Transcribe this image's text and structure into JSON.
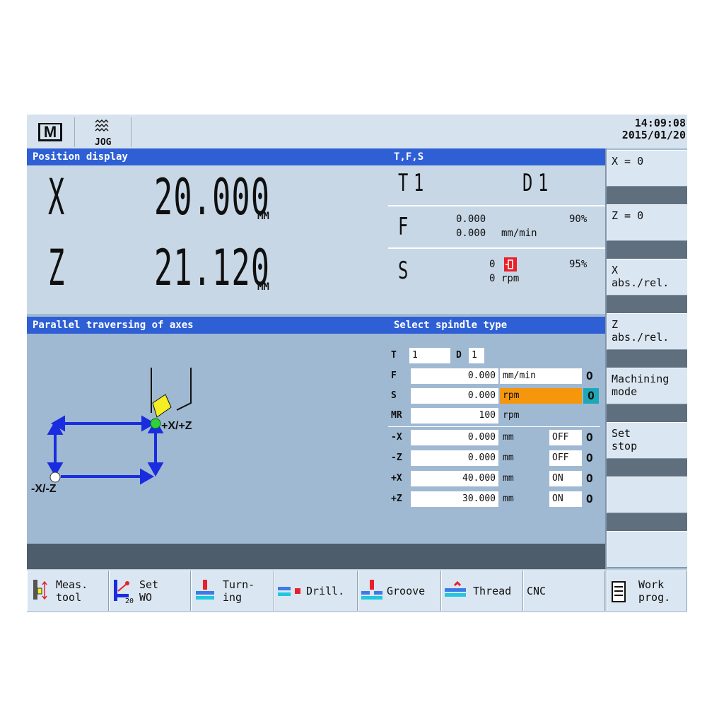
{
  "topbar": {
    "mode_label": "M",
    "jog_label": "JOG",
    "time": "14:09:08",
    "date": "2015/01/20"
  },
  "position": {
    "header": "Position display",
    "axes": [
      {
        "letter": "X",
        "value": "20.000",
        "unit": "MM"
      },
      {
        "letter": "Z",
        "value": "21.120",
        "unit": "MM"
      }
    ]
  },
  "tfs": {
    "header": "T,F,S",
    "t_label": "T",
    "t_value": "1",
    "d_label": "D",
    "d_value": "1",
    "f_label": "F",
    "f_value1": "0.000",
    "f_value2": "0.000",
    "f_unit": "mm/min",
    "f_percent": "90%",
    "s_label": "S",
    "s_value1": "0",
    "s_value2": "0",
    "s_unit": "rpm",
    "s_percent": "95%"
  },
  "traverse": {
    "header": "Parallel traversing of axes",
    "plus_label": "+X/+Z",
    "minus_label": "-X/-Z"
  },
  "spindle": {
    "header": "Select spindle type",
    "t_label": "T",
    "t_value": "1",
    "d_label": "D",
    "d_value": "1",
    "rows": [
      {
        "label": "F",
        "value": "0.000",
        "unit": "mm/min",
        "highlight": false
      },
      {
        "label": "S",
        "value": "0.000",
        "unit": "rpm",
        "highlight": true
      },
      {
        "label": "MR",
        "value": "100",
        "unit": "rpm",
        "highlight": false
      }
    ],
    "limits": [
      {
        "label": "-X",
        "value": "0.000",
        "unit": "mm",
        "state": "OFF"
      },
      {
        "label": "-Z",
        "value": "0.000",
        "unit": "mm",
        "state": "OFF"
      },
      {
        "label": "+X",
        "value": "40.000",
        "unit": "mm",
        "state": "ON"
      },
      {
        "label": "+Z",
        "value": "30.000",
        "unit": "mm",
        "state": "ON"
      }
    ],
    "cycle_glyph": "O"
  },
  "softkeys": [
    {
      "line1": "X = 0",
      "line2": ""
    },
    {
      "line1": "Z = 0",
      "line2": ""
    },
    {
      "line1": "X",
      "line2": "abs./rel."
    },
    {
      "line1": "Z",
      "line2": "abs./rel."
    },
    {
      "line1": "Machining",
      "line2": "mode"
    },
    {
      "line1": "Set",
      "line2": "stop"
    },
    {
      "line1": "",
      "line2": ""
    },
    {
      "line1": "",
      "line2": ""
    }
  ],
  "bottomkeys": [
    {
      "line1": "Meas.",
      "line2": "tool"
    },
    {
      "line1": "Set",
      "line2": "WO",
      "sub": "20"
    },
    {
      "line1": "Turn-",
      "line2": "ing"
    },
    {
      "line1": "Drill.",
      "line2": ""
    },
    {
      "line1": "Groove",
      "line2": ""
    },
    {
      "line1": "Thread",
      "line2": ""
    },
    {
      "line1": "CNC",
      "line2": ""
    },
    {
      "line1": "Work",
      "line2": "prog."
    }
  ],
  "colors": {
    "header_blue": "#2e5fd5",
    "highlight_orange": "#f5960c",
    "teal": "#1fa7b5",
    "arrow_blue": "#1a2ce0",
    "tool_yellow": "#f4ee22",
    "point_green": "#2fd03a",
    "spindle_red": "#e8202a"
  }
}
